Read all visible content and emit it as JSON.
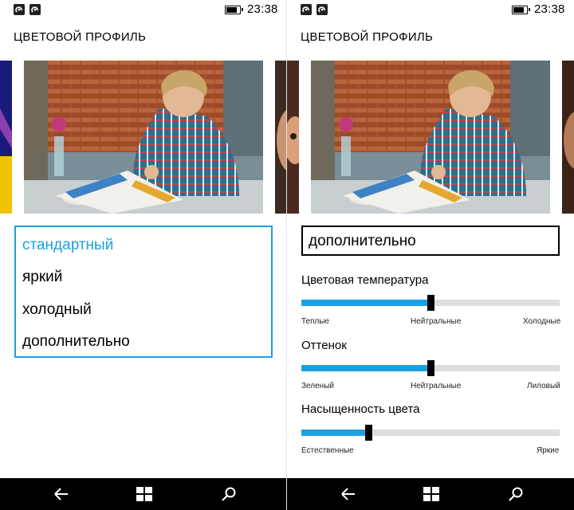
{
  "status": {
    "time": "23:38",
    "battery_level": 0.85,
    "notification_icons": [
      "notification-icon-1",
      "notification-icon-2"
    ]
  },
  "left": {
    "title": "ЦВЕТОВОЙ ПРОФИЛЬ",
    "profiles": [
      {
        "label": "стандартный",
        "selected": true
      },
      {
        "label": "яркий",
        "selected": false
      },
      {
        "label": "холодный",
        "selected": false
      },
      {
        "label": "дополнительно",
        "selected": false
      }
    ]
  },
  "right": {
    "title": "ЦВЕТОВОЙ ПРОФИЛЬ",
    "selected_mode": "дополнительно",
    "sliders": [
      {
        "label": "Цветовая температура",
        "value": 0.5,
        "min_label": "Теплые",
        "mid_label": "Нейтральные",
        "max_label": "Холодные"
      },
      {
        "label": "Оттенок",
        "value": 0.5,
        "min_label": "Зеленый",
        "mid_label": "Нейтральные",
        "max_label": "Лиловый"
      },
      {
        "label": "Насыщенность цвета",
        "value": 0.26,
        "min_label": "Естественные",
        "mid_label": "",
        "max_label": "Яркие"
      }
    ]
  },
  "colors": {
    "accent": "#1ba1e2",
    "track": "#dedede",
    "navbar": "#000000"
  },
  "navbar_icons": [
    "back-arrow-icon",
    "windows-logo-icon",
    "search-icon"
  ]
}
